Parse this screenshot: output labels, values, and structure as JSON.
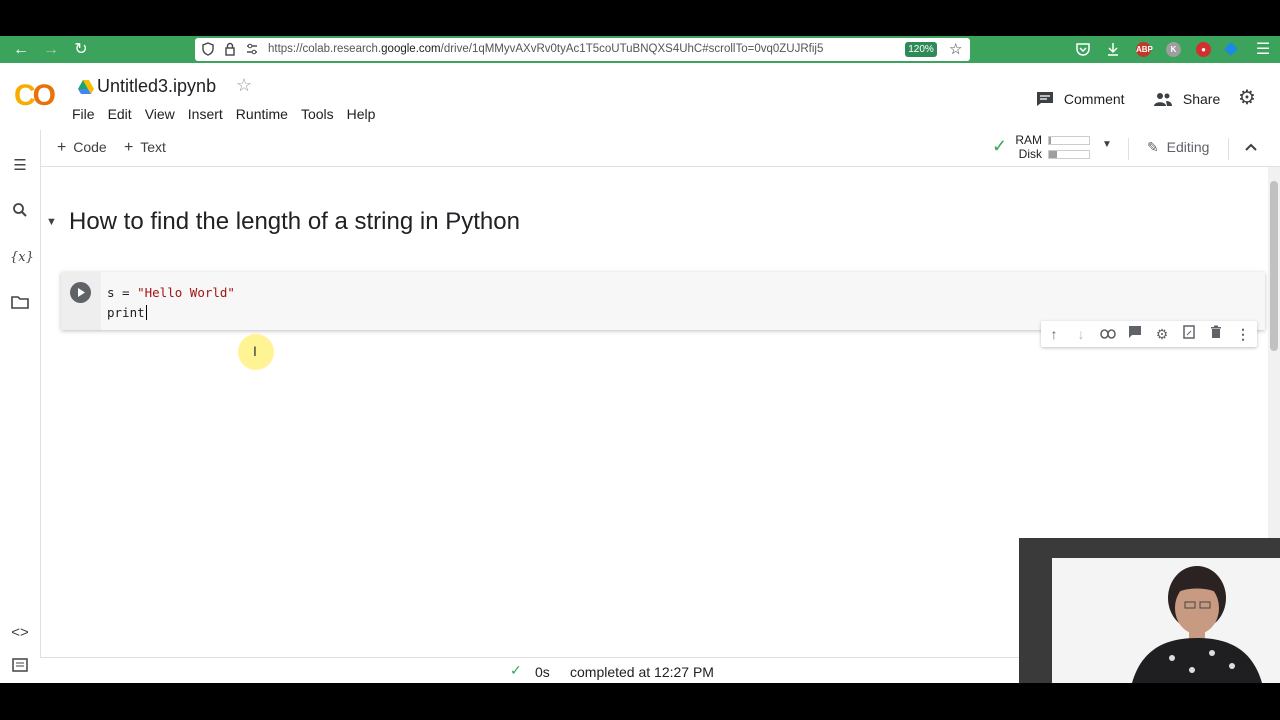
{
  "browser": {
    "url_prefix": "https://colab.research.",
    "url_domain": "google.com",
    "url_suffix": "/drive/1qMMyvAXvRv0tyAc1T5coUTuBNQXS4UhC#scrollTo=0vq0ZUJRfij5",
    "zoom": "120%"
  },
  "header": {
    "title": "Untitled3.ipynb",
    "menu": [
      "File",
      "Edit",
      "View",
      "Insert",
      "Runtime",
      "Tools",
      "Help"
    ],
    "comment_label": "Comment",
    "share_label": "Share"
  },
  "toolbar": {
    "add_code_label": "Code",
    "add_text_label": "Text",
    "ram_label": "RAM",
    "disk_label": "Disk",
    "ram_usage": 0.05,
    "disk_usage": 0.2,
    "editing_label": "Editing"
  },
  "notebook": {
    "heading": "How to find the length of a string in Python",
    "cell": {
      "line1_var": "s = ",
      "line1_str": "\"Hello World\"",
      "line2": "print"
    }
  },
  "status": {
    "time": "0s",
    "message": "completed at 12:27 PM"
  },
  "colors": {
    "browser_bar": "#3ba35b",
    "logo_yellow": "#f9ab00",
    "logo_orange": "#e8710a",
    "check_green": "#34a853"
  }
}
